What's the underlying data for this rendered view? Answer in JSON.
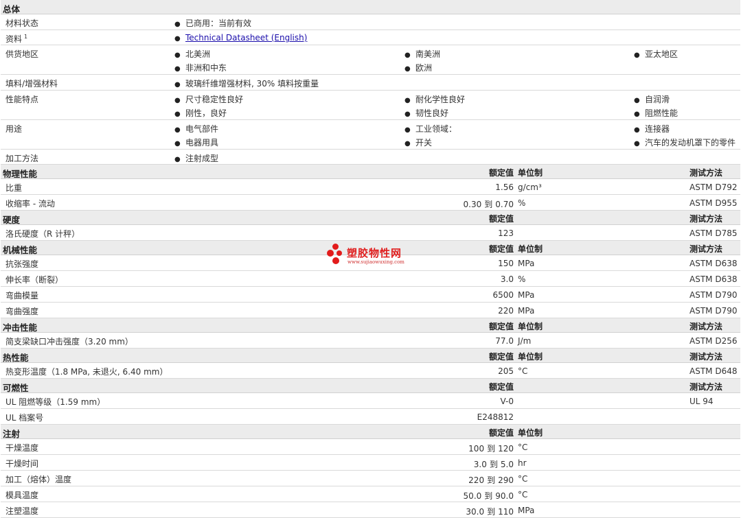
{
  "sections": {
    "general": "总体",
    "physical": "物理性能",
    "hardness": "硬度",
    "mechanical": "机械性能",
    "impact": "冲击性能",
    "thermal": "热性能",
    "flammability": "可燃性",
    "injection": "注射"
  },
  "headers": {
    "nominal": "额定值",
    "unit": "单位制",
    "test": "测试方法"
  },
  "general": {
    "status": {
      "label": "材料状态",
      "value": "已商用：当前有效"
    },
    "docs": {
      "label": "资料",
      "sup": "1",
      "link": "Technical Datasheet (English)"
    },
    "regions": {
      "label": "供货地区",
      "items": [
        "北美洲",
        "南美洲",
        "亚太地区",
        "非洲和中东",
        "欧洲"
      ]
    },
    "filler": {
      "label": "填料/增强材料",
      "value": "玻璃纤维增强材料, 30% 填料按重量"
    },
    "features": {
      "label": "性能特点",
      "items": [
        "尺寸稳定性良好",
        "耐化学性良好",
        "自润滑",
        "刚性，良好",
        "韧性良好",
        "阻燃性能"
      ]
    },
    "uses": {
      "label": "用途",
      "items": [
        "电气部件",
        "工业领域：",
        "连接器",
        "电器用具",
        "开关",
        "汽车的发动机罩下的零件"
      ]
    },
    "processing": {
      "label": "加工方法",
      "value": "注射成型"
    }
  },
  "physical": [
    {
      "label": "比重",
      "value": "1.56",
      "unit": "g/cm³",
      "test": "ASTM D792"
    },
    {
      "label": "收缩率 - 流动",
      "from": "0.30",
      "to_word": "到",
      "to": "0.70",
      "unit": "%",
      "test": "ASTM D955"
    }
  ],
  "hardness": [
    {
      "label": "洛氏硬度（R 计秤）",
      "value": "123",
      "unit": "",
      "test": "ASTM D785"
    }
  ],
  "mechanical": [
    {
      "label": "抗张强度",
      "value": "150",
      "unit": "MPa",
      "test": "ASTM D638"
    },
    {
      "label": "伸长率（断裂）",
      "value": "3.0",
      "unit": "%",
      "test": "ASTM D638"
    },
    {
      "label": "弯曲模量",
      "value": "6500",
      "unit": "MPa",
      "test": "ASTM D790"
    },
    {
      "label": "弯曲强度",
      "value": "220",
      "unit": "MPa",
      "test": "ASTM D790"
    }
  ],
  "impact": [
    {
      "label": "简支梁缺口冲击强度（3.20 mm）",
      "value": "77.0",
      "unit": "J/m",
      "test": "ASTM D256"
    }
  ],
  "thermal": [
    {
      "label": "热变形温度（1.8 MPa, 未退火, 6.40 mm）",
      "value": "205",
      "unit": "°C",
      "test": "ASTM D648"
    }
  ],
  "flammability": [
    {
      "label": "UL 阻燃等级（1.59 mm）",
      "value": "V-0",
      "unit": "",
      "test": "UL 94"
    },
    {
      "label": "UL 档案号",
      "value": "E248812",
      "unit": "",
      "test": ""
    }
  ],
  "injection": [
    {
      "label": "干燥温度",
      "from": "100",
      "to_word": "到",
      "to": "120",
      "unit": "°C"
    },
    {
      "label": "干燥时间",
      "from": "3.0",
      "to_word": "到",
      "to": "5.0",
      "unit": "hr"
    },
    {
      "label": "加工（熔体）温度",
      "from": "220",
      "to_word": "到",
      "to": "290",
      "unit": "°C"
    },
    {
      "label": "模具温度",
      "from": "50.0",
      "to_word": "到",
      "to": "90.0",
      "unit": "°C"
    },
    {
      "label": "注塑温度",
      "from": "30.0",
      "to_word": "到",
      "to": "110",
      "unit": "MPa"
    }
  ],
  "watermark": {
    "title": "塑胶物性网",
    "url": "www.sujiaowuxing.com"
  },
  "colors": {
    "section_bg": "#ececec",
    "link": "#1a0dab",
    "watermark": "#e21b1b"
  }
}
